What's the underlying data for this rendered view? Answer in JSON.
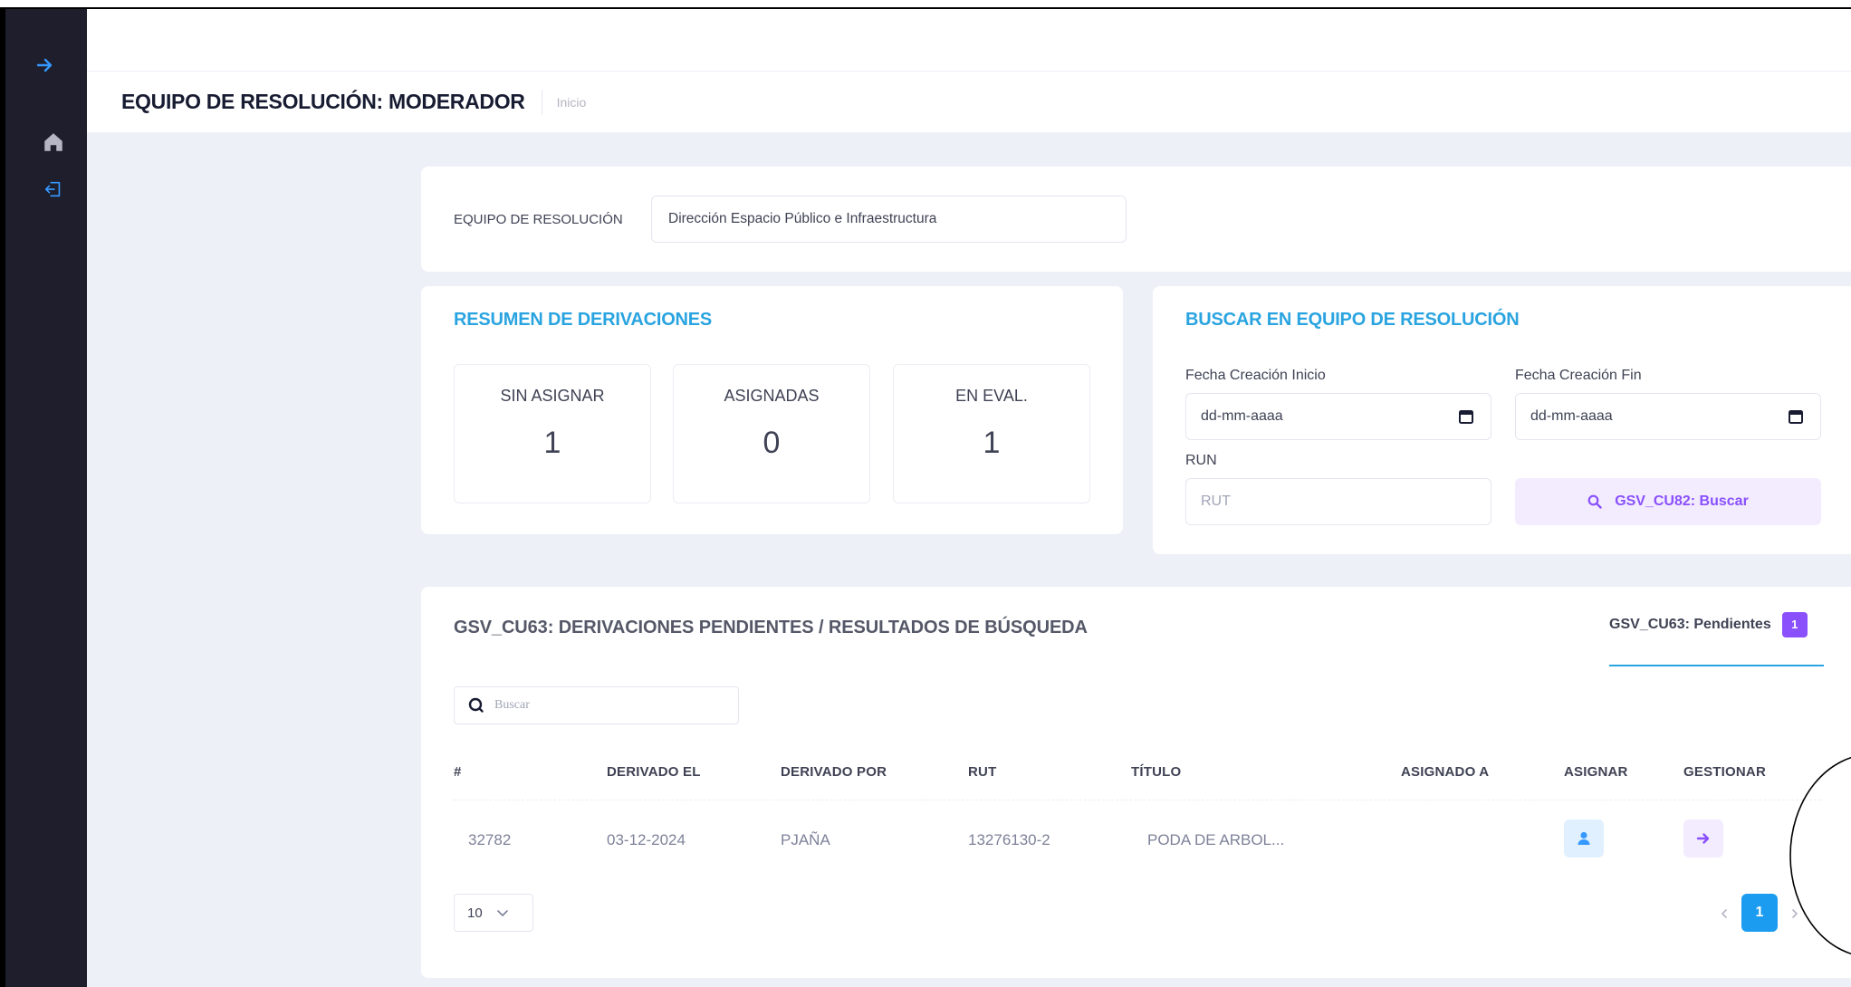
{
  "header": {
    "title": "EQUIPO DE RESOLUCIÓN: MODERADOR",
    "breadcrumb": "Inicio"
  },
  "sidebar": {
    "icons": [
      "arrow-right-icon",
      "home-icon",
      "logout-icon"
    ]
  },
  "team": {
    "label": "EQUIPO DE RESOLUCIÓN",
    "selected": "Dirección Espacio Público e Infraestructura"
  },
  "summary": {
    "title": "RESUMEN DE DERIVACIONES",
    "stats": [
      {
        "label": "SIN ASIGNAR",
        "value": "1"
      },
      {
        "label": "ASIGNADAS",
        "value": "0"
      },
      {
        "label": "EN EVAL.",
        "value": "1"
      }
    ]
  },
  "search": {
    "title": "BUSCAR EN EQUIPO DE RESOLUCIÓN",
    "start_label": "Fecha Creación Inicio",
    "start_value": "dd-mm-aaaa",
    "end_label": "Fecha Creación Fin",
    "end_value": "dd-mm-aaaa",
    "run_label": "RUN",
    "run_placeholder": "RUT",
    "button_label": "GSV_CU82: Buscar"
  },
  "table": {
    "title": "GSV_CU63: DERIVACIONES PENDIENTES / RESULTADOS DE BÚSQUEDA",
    "tab_label": "GSV_CU63: Pendientes",
    "tab_count": "1",
    "search_placeholder": "Buscar",
    "columns": [
      "#",
      "DERIVADO EL",
      "DERIVADO POR",
      "RUT",
      "TÍTULO",
      "ASIGNADO A",
      "ASIGNAR",
      "GESTIONAR"
    ],
    "rows": [
      {
        "id": "32782",
        "date": "03-12-2024",
        "by": "PJAÑA",
        "rut": "13276130-2",
        "title": "PODA DE ARBOL...",
        "assigned": ""
      }
    ],
    "page_size": "10",
    "current_page": "1"
  },
  "colors": {
    "sidebar": "#1e1e2d",
    "accent_blue": "#2aa4e0",
    "accent_purple": "#8950fc",
    "page_bg": "#eef0f8"
  }
}
